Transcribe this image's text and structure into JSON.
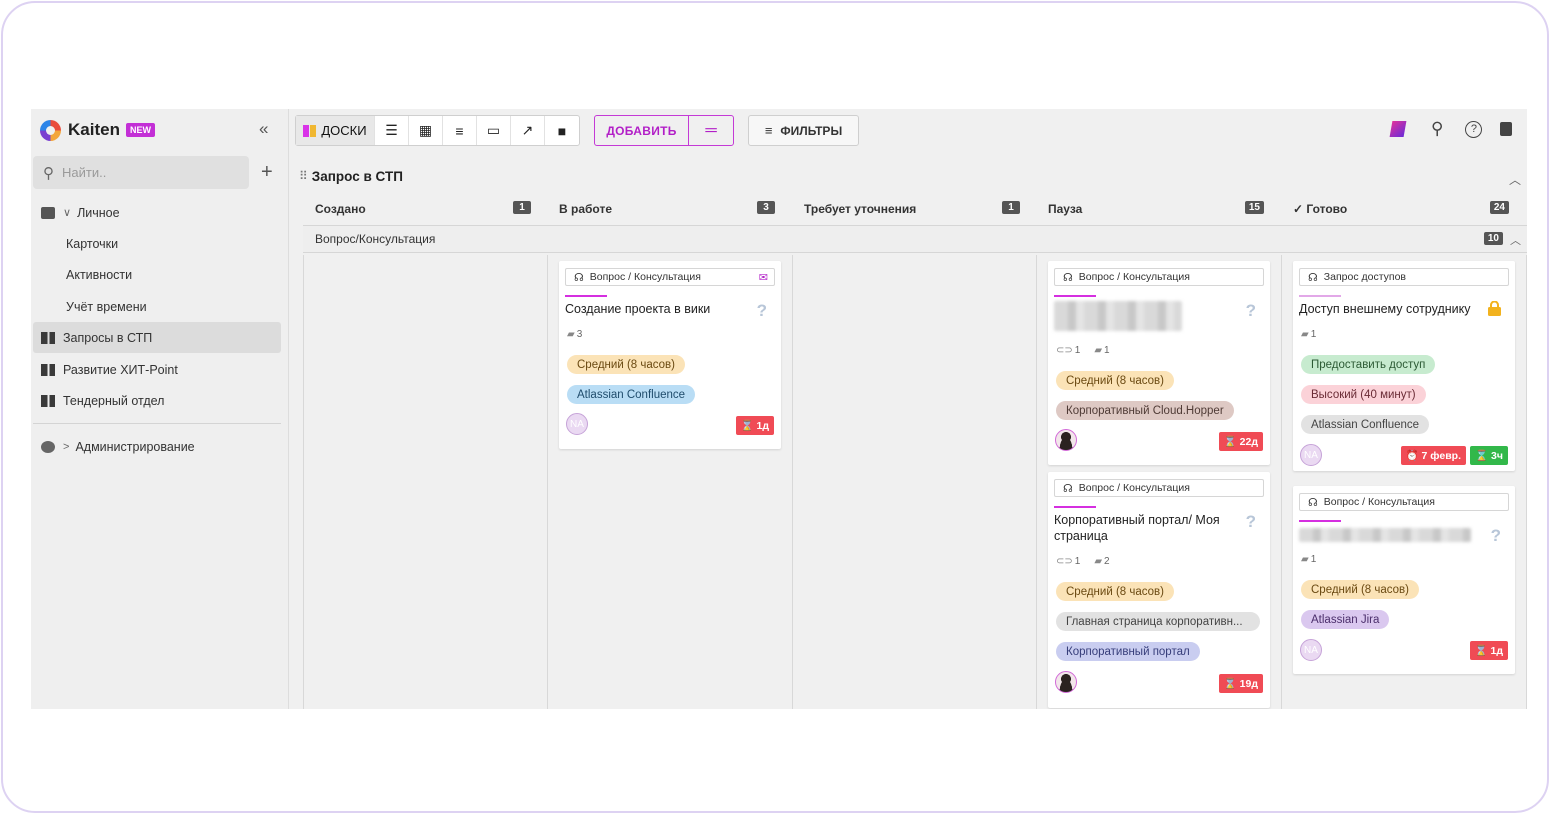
{
  "app": {
    "logo_text": "Kaiten",
    "new_badge": "NEW",
    "collapse_glyph": "«"
  },
  "search": {
    "placeholder": "Найти..",
    "plus": "+"
  },
  "sidebar": {
    "personal": {
      "label": "Личное",
      "chevron": "∨"
    },
    "personal_items": [
      "Карточки",
      "Активности",
      "Учёт времени"
    ],
    "boards": [
      {
        "label": "Запросы в СТП",
        "active": true
      },
      {
        "label": "Развитие ХИТ-Point",
        "active": false
      },
      {
        "label": "Тендерный отдел",
        "active": false
      }
    ],
    "admin": {
      "label": "Администрирование",
      "chevron": ">"
    }
  },
  "toolbar": {
    "boards_label": "ДОСКИ",
    "view_icons": [
      "list-icon",
      "table-icon",
      "timeline-icon",
      "calendar-icon",
      "chart-icon",
      "archive-icon"
    ],
    "add_label": "ДОБАВИТЬ",
    "add_menu_glyph": "═",
    "filters_label": "ФИЛЬТРЫ",
    "filter_glyph": "≡"
  },
  "board": {
    "title": "Запрос в СТП",
    "grip": "⠿",
    "columns": [
      {
        "name": "Создано",
        "count": "1"
      },
      {
        "name": "В работе",
        "count": "3"
      },
      {
        "name": "Требует уточнения",
        "count": "1"
      },
      {
        "name": "Пауза",
        "count": "15"
      },
      {
        "name": "✓ Готово",
        "count": "24"
      }
    ],
    "lane": {
      "name": "Вопрос/Консультация",
      "count": "10"
    }
  },
  "cards": {
    "c1": {
      "type": "Вопрос / Консультация",
      "title": "Создание проекта в вики",
      "comments": "3",
      "tags": [
        "Средний (8 часов)",
        "Atlassian Confluence"
      ],
      "avatar": "NA",
      "timer": "⌛ 1д"
    },
    "c2": {
      "type": "Вопрос / Консультация",
      "attachments": "1",
      "comments": "1",
      "tags": [
        "Средний (8 часов)",
        "Корпоративный Cloud.Hopper"
      ],
      "timer": "⌛ 22д"
    },
    "c3": {
      "type": "Вопрос / Консультация",
      "title": "Корпоративный портал/ Моя страница",
      "attachments": "1",
      "comments": "2",
      "tags": [
        "Средний (8 часов)",
        "Главная страница корпоративн...",
        "Корпоративный портал"
      ],
      "timer": "⌛ 19д"
    },
    "c4": {
      "type": "Запрос доступов",
      "title": "Доступ внешнему сотруднику",
      "comments": "1",
      "tags": [
        "Предоставить доступ",
        "Высокий (40 минут)",
        "Atlassian Confluence"
      ],
      "avatar": "NA",
      "deadline": "⏰ 7 февр.",
      "timer": "⌛ 3ч"
    },
    "c5": {
      "type": "Вопрос / Консультация",
      "comments": "1",
      "tags": [
        "Средний (8 часов)",
        "Atlassian Jira"
      ],
      "avatar": "NA",
      "timer": "⌛ 1д"
    }
  },
  "colors": {
    "accent": "#c43ad6",
    "danger": "#f04b55",
    "success": "#32b84a"
  }
}
